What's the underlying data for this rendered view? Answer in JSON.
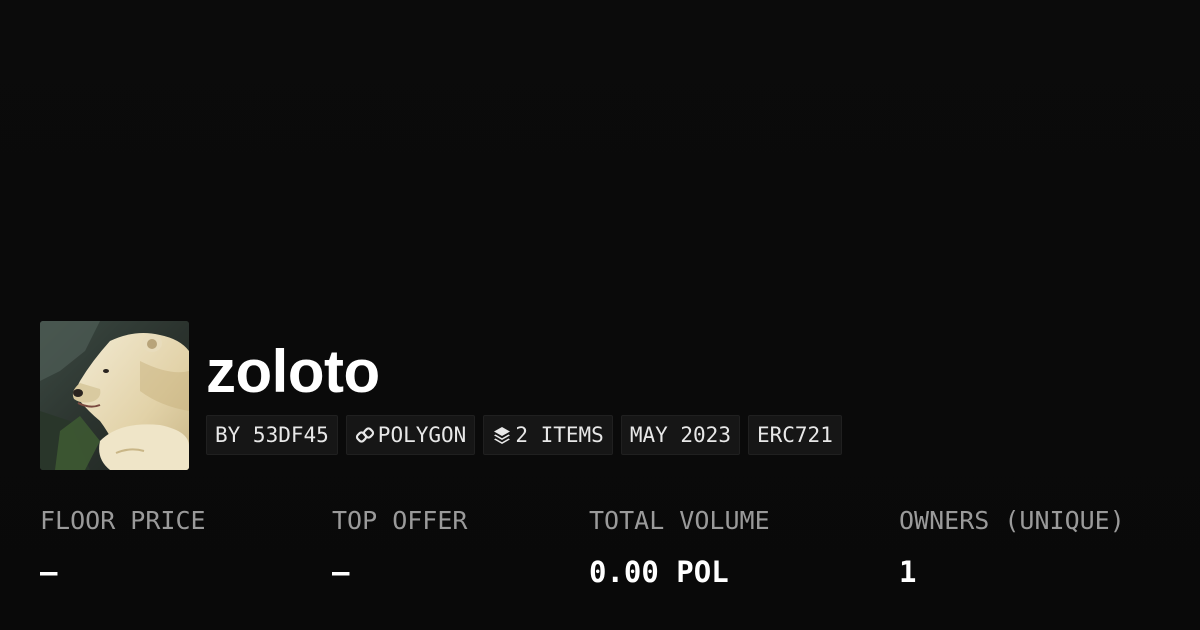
{
  "collection": {
    "name": "zoloto",
    "image_alt": "polar bear"
  },
  "tags": {
    "creator": "BY 53DF45",
    "chain": "POLYGON",
    "items": "2 ITEMS",
    "date": "MAY 2023",
    "standard": "ERC721"
  },
  "icons": {
    "chain": "chain-link-icon",
    "items": "layers-icon"
  },
  "stats": {
    "floor_price": {
      "label": "FLOOR PRICE",
      "value": "–"
    },
    "top_offer": {
      "label": "TOP OFFER",
      "value": "–"
    },
    "total_volume": {
      "label": "TOTAL VOLUME",
      "value": "0.00 POL"
    },
    "owners": {
      "label": "OWNERS (UNIQUE)",
      "value": "1"
    }
  },
  "colors": {
    "background": "#0a0a0a",
    "tag_background": "#161616",
    "label": "#9a9a9a",
    "value": "#ffffff"
  }
}
